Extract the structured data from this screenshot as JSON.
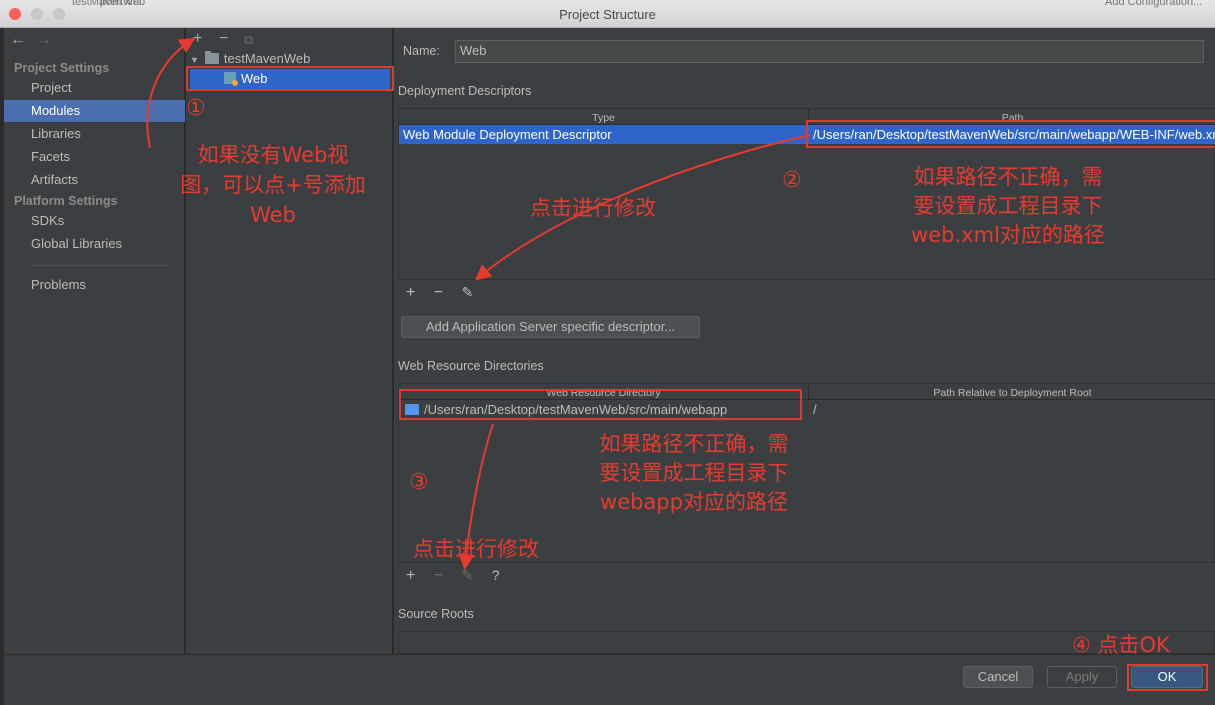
{
  "window": {
    "title": "Project Structure",
    "bg_tab_1": "testMavenWeb",
    "bg_tab_2": "pom.xml",
    "bg_tab_3": "Add Configuration..."
  },
  "nav": {
    "back_icon": "←",
    "forward_icon": "→",
    "project_settings_header": "Project Settings",
    "project": "Project",
    "modules": "Modules",
    "libraries": "Libraries",
    "facets": "Facets",
    "artifacts": "Artifacts",
    "platform_settings_header": "Platform Settings",
    "sdks": "SDKs",
    "global_libraries": "Global Libraries",
    "problems": "Problems"
  },
  "tree": {
    "add_icon": "+",
    "remove_icon": "−",
    "copy_icon": "⧉",
    "expand_icon": "▼",
    "project_node": "testMavenWeb",
    "web_node": "Web"
  },
  "form": {
    "name_label": "Name:",
    "name_value": "Web",
    "deployment_descriptors_title": "Deployment Descriptors",
    "dd_col_type": "Type",
    "dd_col_path": "Path",
    "dd_row_type": "Web Module Deployment Descriptor",
    "dd_row_path": "/Users/ran/Desktop/testMavenWeb/src/main/webapp/WEB-INF/web.xml",
    "add_icon": "+",
    "remove_icon": "−",
    "edit_icon": "✎",
    "help_icon": "?",
    "add_server_descriptor_button": "Add Application Server specific descriptor...",
    "web_resource_title": "Web Resource Directories",
    "wr_col_dir": "Web Resource Directory",
    "wr_col_rel": "Path Relative to Deployment Root",
    "wr_row_dir": "/Users/ran/Desktop/testMavenWeb/src/main/webapp",
    "wr_row_rel": "/",
    "source_roots_title": "Source Roots"
  },
  "footer": {
    "cancel": "Cancel",
    "apply": "Apply",
    "ok": "OK"
  },
  "annotations": {
    "n1": "①",
    "n1_text_line1": "如果没有Web视",
    "n1_text_line2": "图，可以点+号添加",
    "n1_text_line3": "Web",
    "n2": "②",
    "n2_text_line1": "如果路径不正确，需",
    "n2_text_line2": "要设置成工程目录下",
    "n2_text_line3": "web.xml对应的路径",
    "click_edit_1": "点击进行修改",
    "n3": "③",
    "n3_text_line1": "如果路径不正确，需",
    "n3_text_line2": "要设置成工程目录下",
    "n3_text_line3": "webapp对应的路径",
    "click_edit_2": "点击进行修改",
    "n4": "④ 点击OK"
  },
  "colors": {
    "selection": "#4b6eaf",
    "annotation_red": "#e8392f",
    "panel_bg": "#3c3f41"
  }
}
